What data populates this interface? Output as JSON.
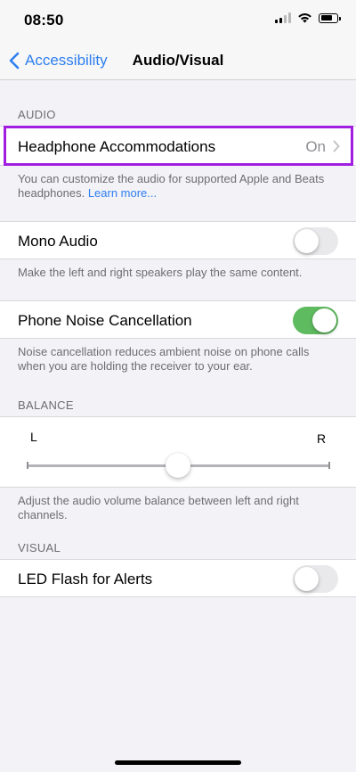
{
  "status": {
    "time": "08:50"
  },
  "nav": {
    "back_label": "Accessibility",
    "title": "Audio/Visual"
  },
  "audio": {
    "header": "AUDIO",
    "headphone": {
      "label": "Headphone Accommodations",
      "value": "On"
    },
    "headphone_footer": "You can customize the audio for supported Apple and Beats headphones.",
    "headphone_footer_link": "Learn more...",
    "mono": {
      "label": "Mono Audio",
      "enabled": false
    },
    "mono_footer": "Make the left and right speakers play the same content.",
    "noise": {
      "label": "Phone Noise Cancellation",
      "enabled": true
    },
    "noise_footer": "Noise cancellation reduces ambient noise on phone calls when you are holding the receiver to your ear."
  },
  "balance": {
    "header": "BALANCE",
    "left": "L",
    "right": "R",
    "position": 0.5,
    "footer": "Adjust the audio volume balance between left and right channels."
  },
  "visual": {
    "header": "VISUAL",
    "led": {
      "label": "LED Flash for Alerts",
      "enabled": false
    }
  },
  "colors": {
    "accent": "#2f7ff0",
    "toggle_on": "#5fbb5f",
    "highlight": "#a11ee0"
  }
}
